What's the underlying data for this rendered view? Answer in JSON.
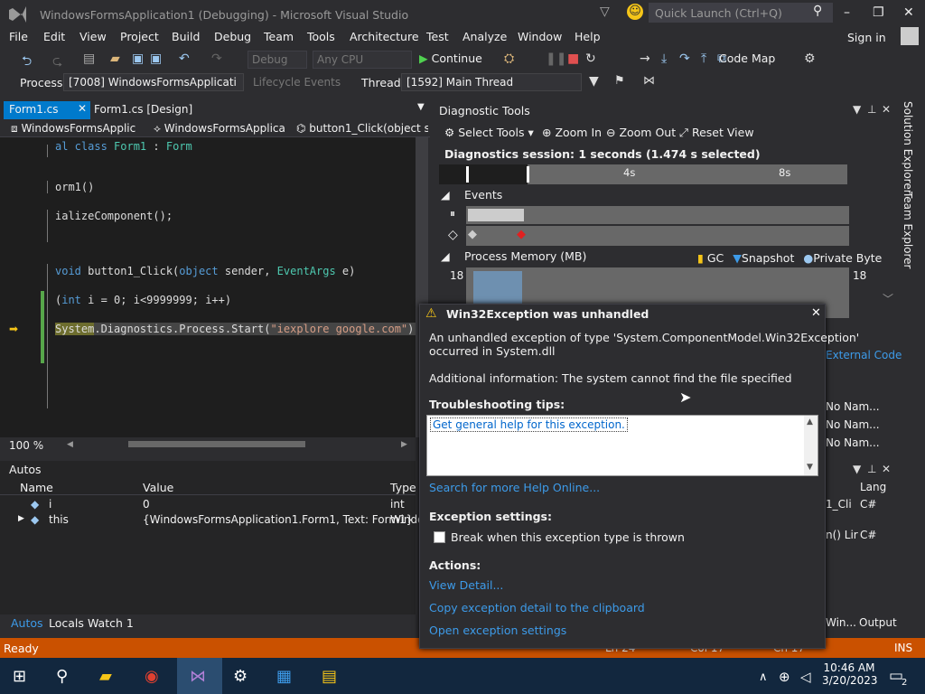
{
  "window": {
    "title": "WindowsFormsApplication1 (Debugging) - Microsoft Visual Studio",
    "quick_launch_placeholder": "Quick Launch (Ctrl+Q)",
    "sign_in": "Sign in"
  },
  "menu": [
    "File",
    "Edit",
    "View",
    "Project",
    "Build",
    "Debug",
    "Team",
    "Tools",
    "Architecture",
    "Test",
    "Analyze",
    "Window",
    "Help"
  ],
  "toolbar": {
    "config": "Debug",
    "platform": "Any CPU",
    "continue": "Continue",
    "code_map": "Code Map"
  },
  "toolbar2": {
    "process_label": "Process:",
    "process": "[7008] WindowsFormsApplicati",
    "lifecycle": "Lifecycle Events",
    "thread_label": "Thread:",
    "thread": "[1592] Main Thread"
  },
  "tabs": {
    "active": "Form1.cs",
    "other": "Form1.cs [Design]"
  },
  "navbar": {
    "project": "WindowsFormsApplic",
    "class": "WindowsFormsApplica",
    "member": "button1_Click(object s"
  },
  "code": {
    "l1a": "al class ",
    "l1b": "Form1",
    "l1c": " : ",
    "l1d": "Form",
    "l2": "orm1()",
    "l3": "ializeComponent();",
    "l4a": "void",
    "l4b": " button1_Click(",
    "l4c": "object",
    "l4d": " sender, ",
    "l4e": "EventArgs",
    "l4f": " e)",
    "l5a": "(",
    "l5b": "int",
    "l5c": " i = 0; i<9999999; i++)",
    "l6a": "System",
    "l6b": ".Diagnostics.Process.Start(",
    "l6c": "\"iexplore google.com\"",
    "l6d": ");"
  },
  "zoom": "100 %",
  "diagnostic": {
    "title": "Diagnostic Tools",
    "select_tools": "Select Tools",
    "zoom_in": "Zoom In",
    "zoom_out": "Zoom Out",
    "reset_view": "Reset View",
    "session": "Diagnostics session: 1 seconds (1.474 s selected)",
    "tick1": "4s",
    "tick2": "8s",
    "events": "Events",
    "process_memory": "Process Memory (MB)",
    "gc": "GC",
    "snapshot": "Snapshot",
    "private_bytes": "Private Bytes",
    "mem_max": "18"
  },
  "side_tabs": [
    "Solution Explorer",
    "Team Explorer"
  ],
  "callstack": {
    "external": "External Code",
    "rows": [
      "No Nam...",
      "No Nam...",
      "No Nam..."
    ]
  },
  "autos": {
    "title": "Autos",
    "headers": [
      "Name",
      "Value",
      "Type"
    ],
    "rows": [
      {
        "name": "i",
        "value": "0",
        "type": "int"
      },
      {
        "name": "this",
        "value": "{WindowsFormsApplication1.Form1, Text: Form1}",
        "type": "Windo"
      }
    ],
    "tabs": [
      "Autos",
      "Locals",
      "Watch 1"
    ]
  },
  "lang_panel": {
    "header": "Lang",
    "rows": [
      {
        "a": "1_Cli",
        "b": "C#"
      },
      {
        "a": "n() Lir",
        "b": "C#"
      }
    ],
    "bottom_tabs": [
      "Win...",
      "Output"
    ]
  },
  "dialog": {
    "title": "Win32Exception was unhandled",
    "msg1": "An unhandled exception of type 'System.ComponentModel.Win32Exception'",
    "msg2": "occurred in System.dll",
    "additional": "Additional information: The system cannot find the file specified",
    "tips_label": "Troubleshooting tips:",
    "tip_link": "Get general help for this exception.",
    "help_online": "Search for more Help Online...",
    "exc_settings": "Exception settings:",
    "break_when": "Break when this exception type is thrown",
    "actions": "Actions:",
    "view_detail": "View Detail...",
    "copy_detail": "Copy exception detail to the clipboard",
    "open_settings": "Open exception settings"
  },
  "status": {
    "ready": "Ready",
    "ln": "Ln 24",
    "col": "Col 17",
    "ch": "Ch 17",
    "ins": "INS"
  },
  "taskbar": {
    "time": "10:46 AM",
    "date": "3/20/2023",
    "notif": "2"
  }
}
